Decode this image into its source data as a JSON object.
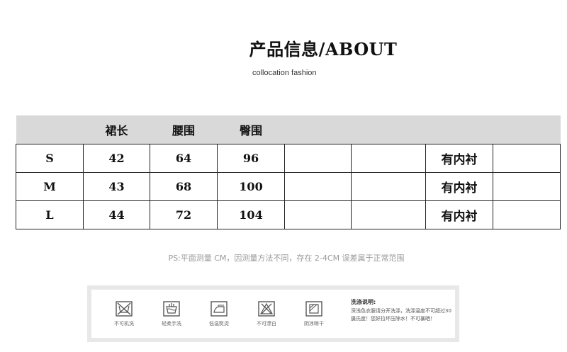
{
  "header": {
    "title": "产品信息/ABOUT",
    "subtitle": "collocation fashion"
  },
  "size_table": {
    "headers": [
      "",
      "裙长",
      "腰围",
      "臀围",
      "",
      "",
      "",
      ""
    ],
    "rows": [
      [
        "S",
        "42",
        "64",
        "96",
        "",
        "",
        "有内衬",
        ""
      ],
      [
        "M",
        "43",
        "68",
        "100",
        "",
        "",
        "有内衬",
        ""
      ],
      [
        "L",
        "44",
        "72",
        "104",
        "",
        "",
        "有内衬",
        ""
      ]
    ]
  },
  "note": "PS:平面测量 CM，因测量方法不同，存在 2-4CM 误差属于正常范围",
  "care": {
    "icons": [
      {
        "icon": "no-machine-wash-icon",
        "label": "不可机洗"
      },
      {
        "icon": "gentle-hand-wash-icon",
        "label": "轻柔手洗"
      },
      {
        "icon": "low-temp-iron-icon",
        "label": "低温熨烫"
      },
      {
        "icon": "no-bleach-icon",
        "label": "不可漂白"
      },
      {
        "icon": "dry-flat-shade-icon",
        "label": "阴凉晾干"
      }
    ],
    "instructions_title": "洗涤说明:",
    "instructions_body": "深浅色衣服请分开洗涤，洗涤温度不可超过30摄氏度！您好拉坏压除水！不可暴晒！"
  }
}
